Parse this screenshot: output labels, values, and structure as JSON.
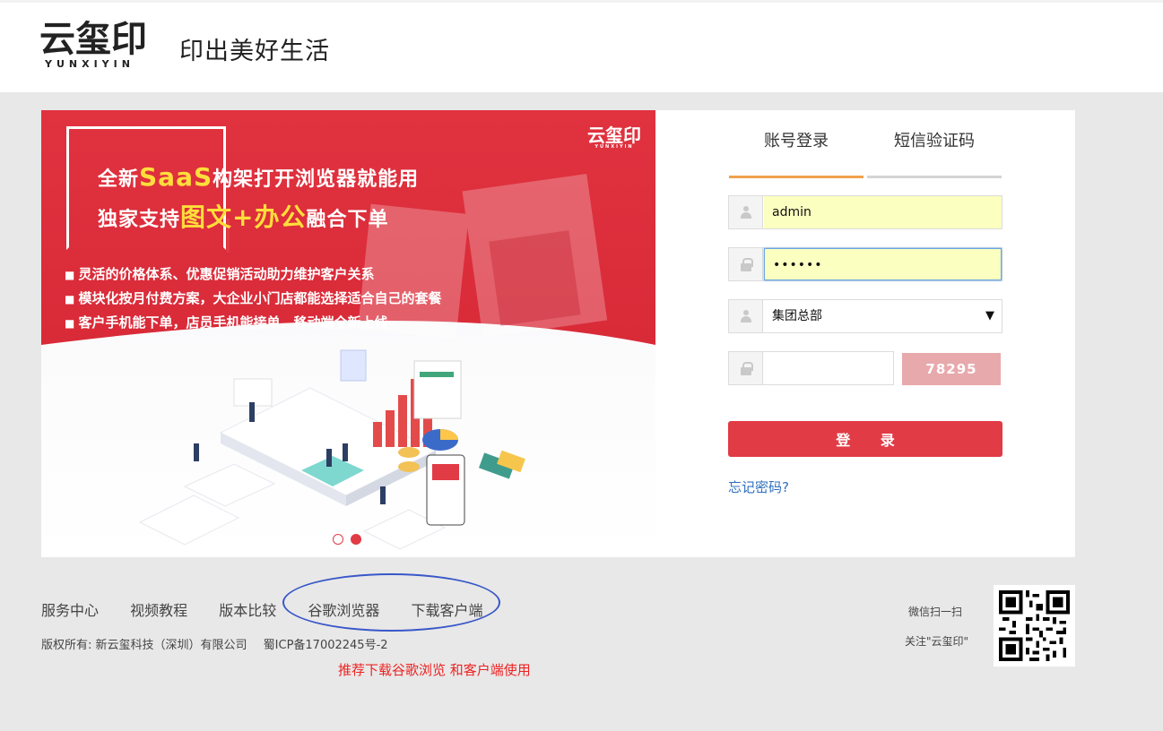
{
  "header": {
    "logo_text": "云玺印",
    "logo_sub": "YUNXIYIN",
    "slogan": "印出美好生活"
  },
  "banner": {
    "logo_text": "云玺印",
    "logo_sub": "YUNXIYIN",
    "line1_pre": "全新",
    "line1_hl": "SaaS",
    "line1_post": "构架打开浏览器就能用",
    "line2_pre": "独家支持",
    "line2_hl": "图文+办公",
    "line2_post": "融合下单",
    "bullets": [
      "灵活的价格体系、优惠促销活动助力维护客户关系",
      "模块化按月付费方案，大企业小门店都能选择适合自己的套餐",
      "客户手机能下单，店员手机能接单，移动端全新上线"
    ],
    "slides_total": 2,
    "slide_active": 2
  },
  "login": {
    "tabs": [
      "账号登录",
      "短信验证码"
    ],
    "active_tab": 0,
    "username": "admin",
    "password_masked": "••••••",
    "store_select": "集团总部",
    "captcha_input": "",
    "captcha_code": "78295",
    "submit_label": "登 录",
    "forgot_label": "忘记密码?"
  },
  "footer": {
    "links": [
      "服务中心",
      "视频教程",
      "版本比较",
      "谷歌浏览器",
      "下载客户端"
    ],
    "copyright": "版权所有: 新云玺科技（深圳）有限公司",
    "icp": "蜀ICP备17002245号-2",
    "note": "推荐下载谷歌浏览 和客户端使用",
    "wechat_line1": "微信扫一扫",
    "wechat_line2": "关注\"云玺印\""
  },
  "colors": {
    "brand_red": "#e13b46",
    "tab_active": "#f0a24d",
    "link_blue": "#2f6fbf",
    "highlight_yellow": "#ffde3b",
    "annotation_oval": "#3957c9"
  }
}
